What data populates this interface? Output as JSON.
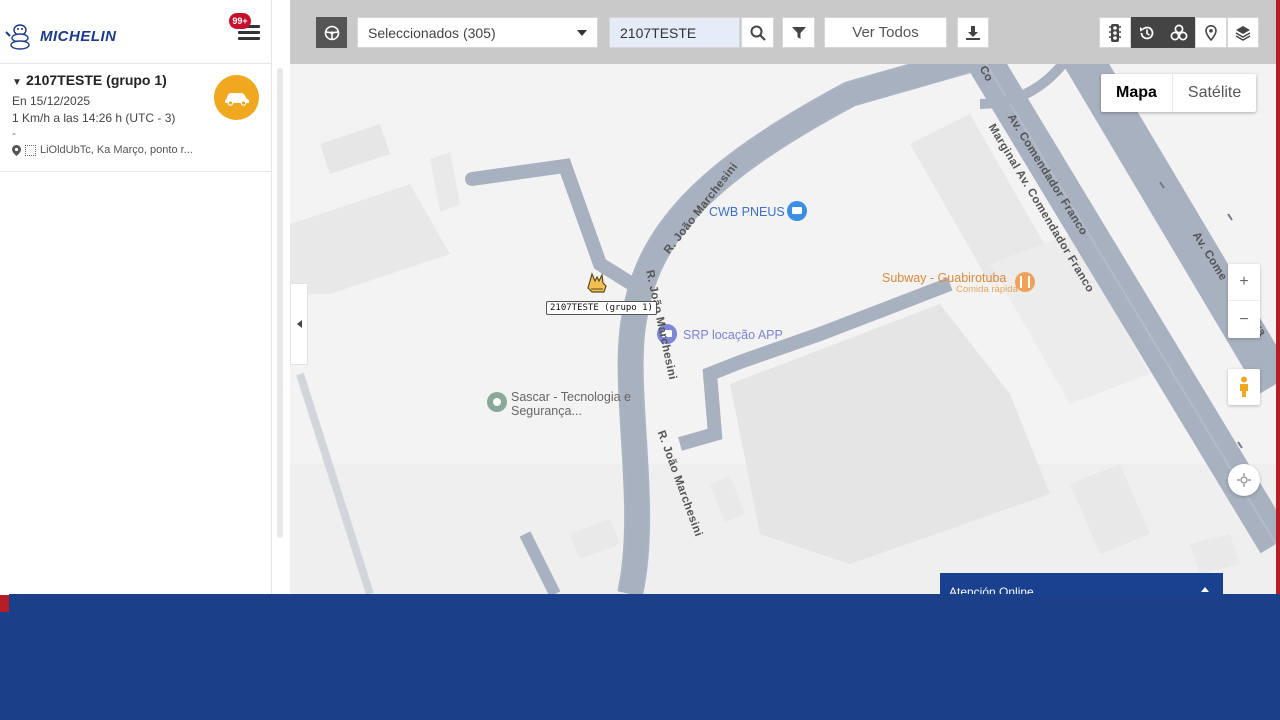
{
  "app": {
    "brand": "MICHELIN",
    "notifications_badge": "99+"
  },
  "vehicle": {
    "title": "2107TESTE (grupo 1)",
    "date": "En 15/12/2025",
    "speed": "1 Km/h a las 14:26 h (UTC - 3)",
    "dash": "-",
    "address": "LiOldUbTc, Ka Março, ponto r..."
  },
  "toolbar": {
    "select_value": "Seleccionados (305)",
    "search_value": "2107TESTE",
    "ver_todos": "Ver Todos"
  },
  "map": {
    "type_buttons": {
      "map": "Mapa",
      "satellite": "Satélite"
    },
    "zoom_in": "+",
    "zoom_out": "−",
    "vehicle_label": "2107TESTE (grupo 1)",
    "pois": {
      "cwb": "CWB PNEUS",
      "srp": "SRP locação APP",
      "subway": "Subway - Guabirotuba",
      "subway_sub": "Comida rápida",
      "sascar": "Sascar - Tecnologia e Segurança..."
    },
    "streets": {
      "joao_top": "R. João Marchesini",
      "joao_mid": "R. João Marchesini",
      "joao_bottom": "R. João Marchesini",
      "comendador": "Av. Comendador Franco",
      "marginal": "Marginal Av. Comendador Franco",
      "comendador_right": "Av. Come",
      "fr_right": "Fra",
      "co_top": "Co"
    }
  },
  "chat": {
    "label": "Atención Online"
  },
  "colors": {
    "brand_blue": "#1c3f89",
    "status_orange": "#f0a81e",
    "badge_red": "#c8102e"
  }
}
